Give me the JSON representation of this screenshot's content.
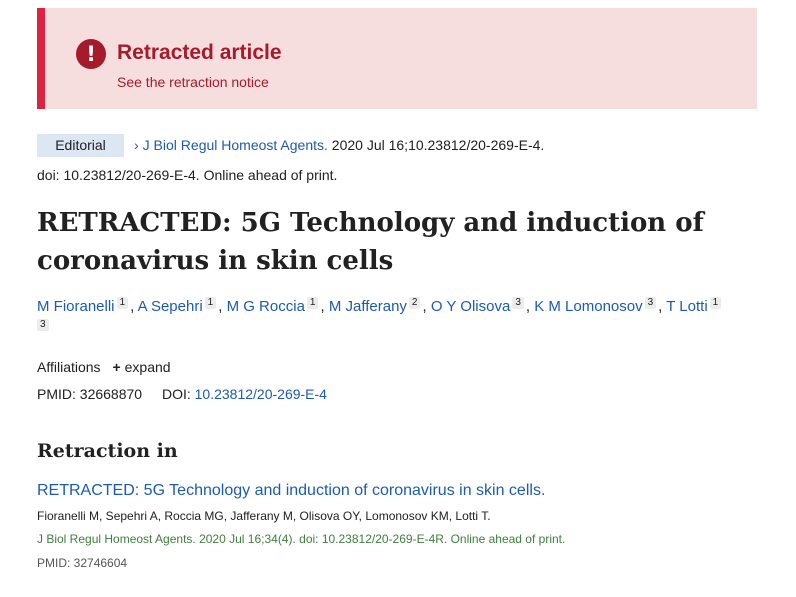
{
  "banner": {
    "icon": "exclamation-icon",
    "title": "Retracted article",
    "link": "See the retraction notice",
    "colors": {
      "background": "#f7dede",
      "accent": "#dc2342",
      "text": "#a61b2c"
    }
  },
  "article": {
    "publication_type": "Editorial",
    "journal": "J Biol Regul Homeost Agents.",
    "citation_rest": " 2020 Jul 16;10.23812/20-269-E-4.",
    "doi_line": "doi: 10.23812/20-269-E-4. Online ahead of print.",
    "title": "RETRACTED: 5G Technology and induction of coronavirus in skin cells",
    "authors": [
      {
        "name": "M Fioranelli",
        "aff": "1"
      },
      {
        "name": "A Sepehri",
        "aff": "1"
      },
      {
        "name": "M G Roccia",
        "aff": "1"
      },
      {
        "name": "M Jafferany",
        "aff": "2"
      },
      {
        "name": "O Y Olisova",
        "aff": "3"
      },
      {
        "name": "K M Lomonosov",
        "aff": "3"
      },
      {
        "name": "T Lotti",
        "aff": "1",
        "aff2": "3"
      }
    ],
    "affiliations_label": "Affiliations",
    "expand_label": "expand",
    "pmid_label": "PMID: 32668870",
    "doi_label": "DOI:",
    "doi_value": "10.23812/20-269-E-4"
  },
  "retraction": {
    "heading": "Retraction in",
    "title": "RETRACTED: 5G Technology and induction of coronavirus in skin cells.",
    "authors": "Fioranelli M, Sepehri A, Roccia MG, Jafferany M, Olisova OY, Lomonosov KM, Lotti T.",
    "citation": "J Biol Regul Homeost Agents. 2020 Jul 16;34(4). doi: 10.23812/20-269-E-4R. Online ahead of print.",
    "pmid": "PMID: 32746604"
  },
  "colors": {
    "link": "#1d5bb3",
    "citation_green": "#3f7f3f",
    "pub_type_bg": "#dde6f3"
  }
}
